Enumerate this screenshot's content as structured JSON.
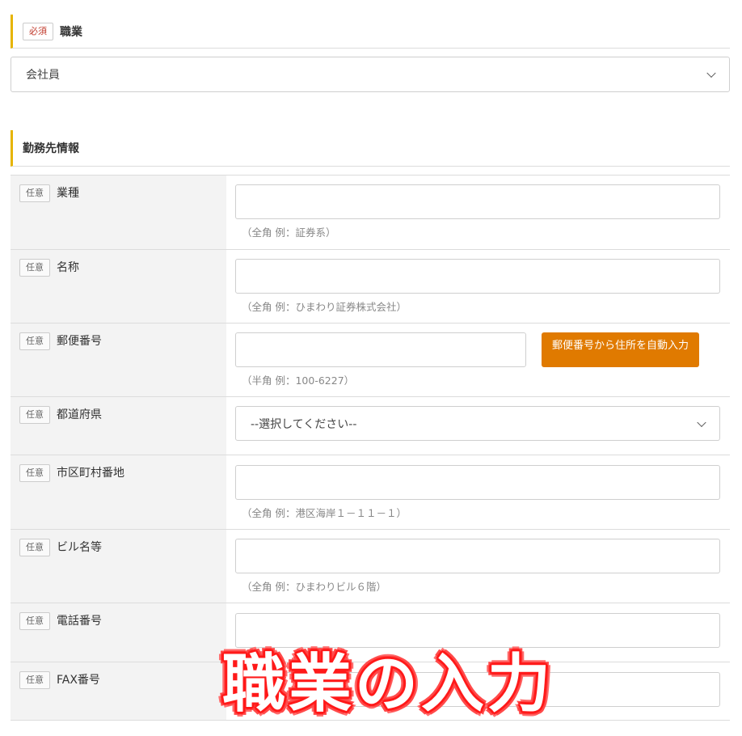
{
  "occupation": {
    "badge": "必須",
    "label": "職業",
    "selected": "会社員"
  },
  "employer": {
    "heading": "勤務先情報",
    "rows": [
      {
        "badge": "任意",
        "label": "業種",
        "hint": "（全角 例：証券系）"
      },
      {
        "badge": "任意",
        "label": "名称",
        "hint": "（全角 例：ひまわり証券株式会社）"
      },
      {
        "badge": "任意",
        "label": "郵便番号",
        "hint": "（半角 例：100-6227）",
        "button": "郵便番号から住所を自動入力"
      },
      {
        "badge": "任意",
        "label": "都道府県",
        "selected": "--選択してください--"
      },
      {
        "badge": "任意",
        "label": "市区町村番地",
        "hint": "（全角 例：港区海岸１－１１－１）"
      },
      {
        "badge": "任意",
        "label": "ビル名等",
        "hint": "（全角 例：ひまわりビル６階）"
      },
      {
        "badge": "任意",
        "label": "電話番号"
      },
      {
        "badge": "任意",
        "label": "FAX番号"
      }
    ]
  },
  "overlay_caption": "職業の入力",
  "colors": {
    "accent_bar": "#e6b400",
    "required_text": "#c0392b",
    "zip_button": "#e07a00",
    "caption_outline": "#ff1a1a"
  },
  "icons": {
    "select_arrow": "chevron-down-icon"
  }
}
